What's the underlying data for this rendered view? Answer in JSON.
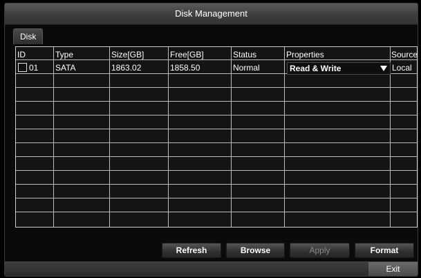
{
  "window": {
    "title": "Disk Management"
  },
  "tabs": [
    {
      "label": "Disk"
    }
  ],
  "table": {
    "columns": [
      "ID",
      "Type",
      "Size[GB]",
      "Free[GB]",
      "Status",
      "Properties",
      "Sources"
    ],
    "rows": [
      {
        "id": "01",
        "type": "SATA",
        "size_gb": "1863.02",
        "free_gb": "1858.50",
        "status": "Normal",
        "properties": "Read & Write",
        "sources": "Local"
      }
    ]
  },
  "buttons": {
    "refresh": "Refresh",
    "browse": "Browse",
    "apply": "Apply",
    "format": "Format",
    "exit": "Exit"
  },
  "icons": {
    "checkbox": "checkbox-icon",
    "dropdown": "triangle-down-icon"
  },
  "colors": {
    "background": "#000000",
    "grid_line": "#bdbdbd",
    "disabled_text": "#8a8a8a"
  }
}
